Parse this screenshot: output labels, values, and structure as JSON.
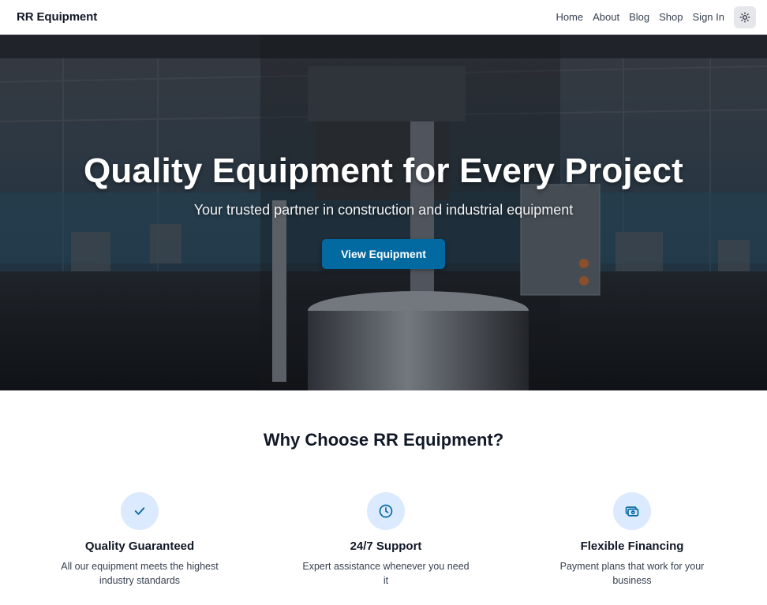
{
  "nav": {
    "brand": "RR Equipment",
    "links": [
      "Home",
      "About",
      "Blog",
      "Shop",
      "Sign In"
    ],
    "theme_toggle_icon": "sun-icon"
  },
  "hero": {
    "title": "Quality Equipment for Every Project",
    "subtitle": "Your trusted partner in construction and industrial equipment",
    "cta_label": "View Equipment",
    "cta_color": "#0369a1"
  },
  "why": {
    "title": "Why Choose RR Equipment?",
    "features": [
      {
        "icon": "check-icon",
        "title": "Quality Guaranteed",
        "description": "All our equipment meets the highest industry standards"
      },
      {
        "icon": "clock-icon",
        "title": "24/7 Support",
        "description": "Expert assistance whenever you need it"
      },
      {
        "icon": "money-icon",
        "title": "Flexible Financing",
        "description": "Payment plans that work for your business"
      }
    ],
    "icon_bg": "#dbeafe",
    "icon_color": "#0369a1"
  }
}
